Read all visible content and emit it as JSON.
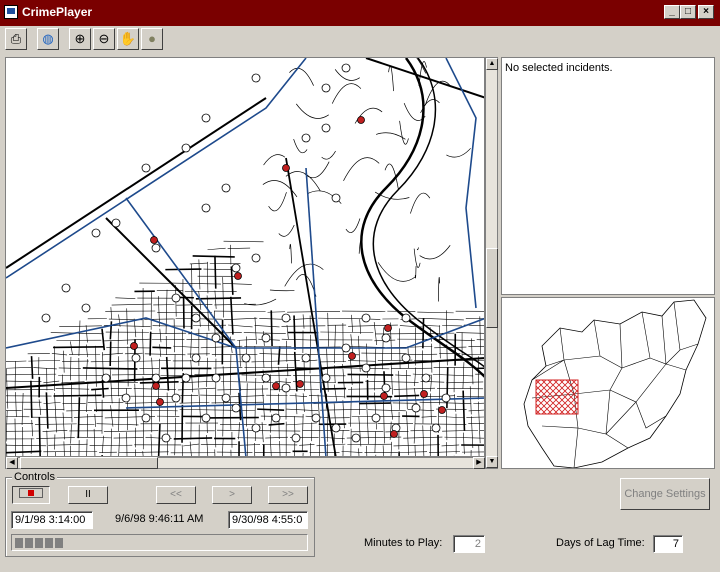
{
  "window": {
    "title": "CrimePlayer",
    "min": "_",
    "max": "□",
    "close": "×"
  },
  "toolbar": [
    {
      "name": "print-button",
      "glyph": "⎙"
    },
    {
      "name": "globe-button",
      "glyph": "◍"
    },
    {
      "name": "zoom-in-button",
      "glyph": "⊕"
    },
    {
      "name": "zoom-out-button",
      "glyph": "⊖"
    },
    {
      "name": "pan-hand-button",
      "glyph": "✋"
    },
    {
      "name": "select-button",
      "glyph": "●"
    }
  ],
  "info_panel": {
    "text": "No selected incidents."
  },
  "controls": {
    "label": "Controls",
    "pause": "II",
    "rewind": "<<",
    "play": ">",
    "fast_forward": ">>",
    "start_date": "9/1/98 3:14:00",
    "current_date": "9/6/98 9:46:11 AM",
    "end_date": "9/30/98 4:55:0",
    "progress_segments": 5
  },
  "change_settings": "Change  Settings",
  "minutes_to_play": {
    "label": "Minutes to Play:",
    "value": "2"
  },
  "days_lag": {
    "label": "Days of Lag Time:",
    "value": "7"
  },
  "colors": {
    "title_bar": "#7a0000",
    "incident_red": "#c02020",
    "boundary_blue": "#1e4a8c"
  },
  "icons": [
    "print-icon",
    "globe-icon",
    "zoom-in-icon",
    "zoom-out-icon",
    "hand-icon",
    "circle-icon",
    "record-icon",
    "scroll-up-icon",
    "scroll-down-icon",
    "scroll-left-icon",
    "scroll-right-icon"
  ]
}
